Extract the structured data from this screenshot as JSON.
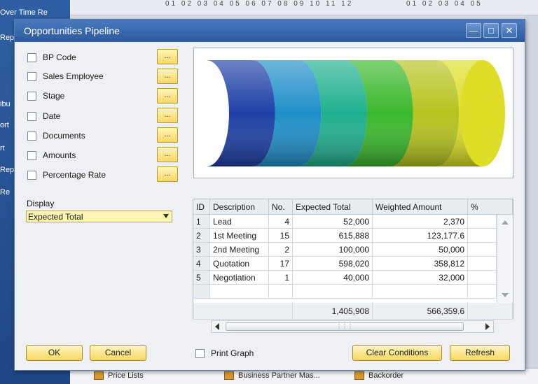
{
  "background": {
    "sidebar_fragments": [
      "Over Time Re",
      "Rep",
      "ibu",
      "ort",
      "rt",
      "Rep",
      "Re"
    ],
    "calendar_left": "01 02 03 04 05 06 07 08 09 10 11 12",
    "calendar_right": "01 02 03 04 05",
    "taskbar": [
      "Price Lists",
      "Business Partner Mas...",
      "Backorder"
    ]
  },
  "dialog": {
    "title": "Opportunities Pipeline",
    "window_buttons": {
      "minimize": "—",
      "maximize": "□",
      "close": "✕"
    },
    "filters": [
      {
        "label": "BP Code",
        "checked": false
      },
      {
        "label": "Sales Employee",
        "checked": false
      },
      {
        "label": "Stage",
        "checked": false
      },
      {
        "label": "Date",
        "checked": false
      },
      {
        "label": "Documents",
        "checked": false
      },
      {
        "label": "Amounts",
        "checked": false
      },
      {
        "label": "Percentage Rate",
        "checked": false
      }
    ],
    "ellipsis_label": "...",
    "display_label": "Display",
    "display_value": "Expected Total",
    "table": {
      "columns": [
        "ID",
        "Description",
        "No.",
        "Expected Total",
        "Weighted Amount",
        "%"
      ],
      "rows": [
        {
          "id": "1",
          "description": "Lead",
          "no": "4",
          "expected_total": "52,000",
          "weighted_amount": "2,370"
        },
        {
          "id": "2",
          "description": "1st Meeting",
          "no": "15",
          "expected_total": "615,888",
          "weighted_amount": "123,177.6"
        },
        {
          "id": "3",
          "description": "2nd Meeting",
          "no": "2",
          "expected_total": "100,000",
          "weighted_amount": "50,000"
        },
        {
          "id": "4",
          "description": "Quotation",
          "no": "17",
          "expected_total": "598,020",
          "weighted_amount": "358,812"
        },
        {
          "id": "5",
          "description": "Negotiation",
          "no": "1",
          "expected_total": "40,000",
          "weighted_amount": "32,000"
        }
      ],
      "totals": {
        "expected_total": "1,405,908",
        "weighted_amount": "566,359.6"
      }
    },
    "pipeline_colors": [
      "#1d3fa6",
      "#1f8fc9",
      "#1fb08e",
      "#3ab82c",
      "#b5c31e",
      "#dede28"
    ],
    "buttons": {
      "ok": "OK",
      "cancel": "Cancel",
      "print_graph": "Print Graph",
      "clear_conditions": "Clear Conditions",
      "refresh": "Refresh"
    },
    "print_graph_checked": false
  }
}
